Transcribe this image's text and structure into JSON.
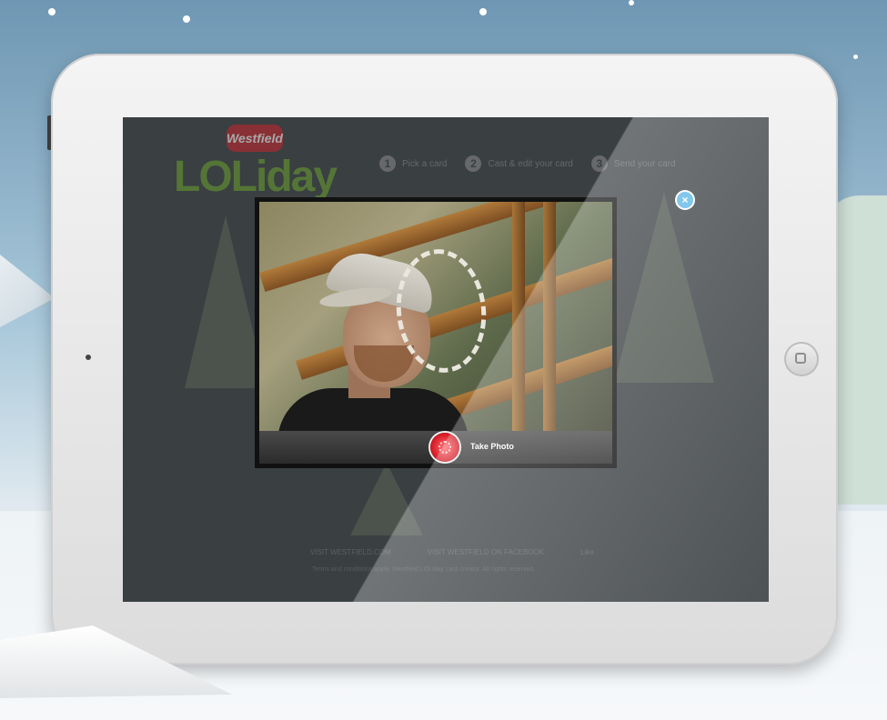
{
  "app": {
    "brand": "Westfield",
    "logo_text": "LOLiday"
  },
  "steps": [
    {
      "number": "1",
      "label": "Pick a card"
    },
    {
      "number": "2",
      "label": "Cast & edit your card"
    },
    {
      "number": "3",
      "label": "Send your card"
    }
  ],
  "footer": {
    "links": [
      "VISIT WESTFIELD.COM",
      "VISIT WESTFIELD ON FACEBOOK",
      "Like"
    ],
    "text": "Terms and conditions apply. Westfield LOLiday card creator. All rights reserved."
  },
  "camera_modal": {
    "take_photo_label": "Take Photo",
    "close_label": "×"
  },
  "icons": {
    "home": "home-button-icon",
    "camera": "camera-shutter-icon",
    "close": "close-icon"
  },
  "colors": {
    "accent_red": "#d91f2a",
    "close_blue": "#5cb6e8",
    "brand_green": "#6aa22e"
  }
}
